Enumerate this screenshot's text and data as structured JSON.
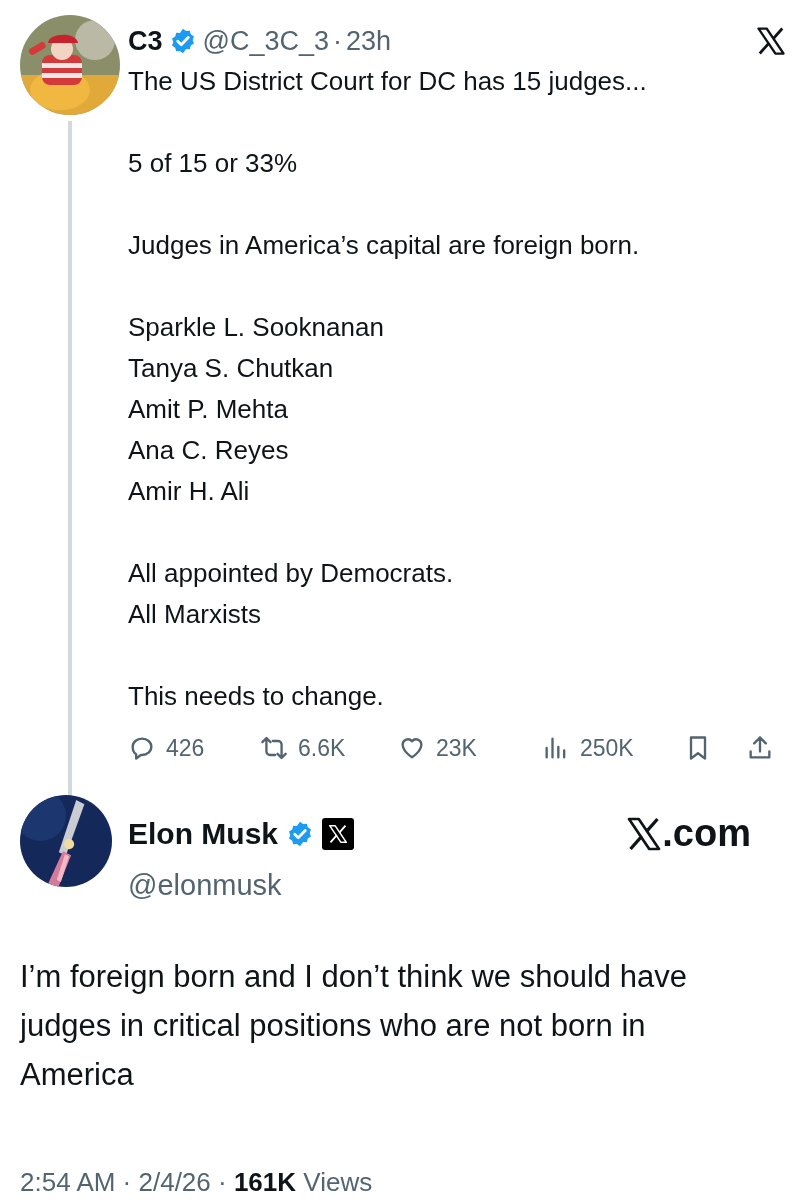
{
  "quoted_post": {
    "name": "C3",
    "handle": "@C_3C_3",
    "separator": "·",
    "time": "23h",
    "paragraphs": [
      "The US District Court for DC has 15 judges...",
      "5 of 15 or 33%",
      "Judges in America’s capital are foreign born.",
      "Sparkle L. Sooknanan\nTanya S. Chutkan\nAmit P. Mehta\nAna C. Reyes\nAmir H. Ali",
      "All appointed by Democrats.\nAll Marxists",
      "This needs to change."
    ],
    "actions": [
      {
        "kind": "reply",
        "count": "426"
      },
      {
        "kind": "repost",
        "count": "6.6K"
      },
      {
        "kind": "like",
        "count": "23K"
      },
      {
        "kind": "views",
        "count": "250K"
      },
      {
        "kind": "bookmark"
      },
      {
        "kind": "share"
      }
    ]
  },
  "reply_post": {
    "name": "Elon Musk",
    "handle": "@elonmusk",
    "site": ".com",
    "text": "I’m foreign born and I don’t think we should have judges in critical positions who are not born in America",
    "footer": "2:54 AM · 2/4/26 · **161K** Views"
  }
}
